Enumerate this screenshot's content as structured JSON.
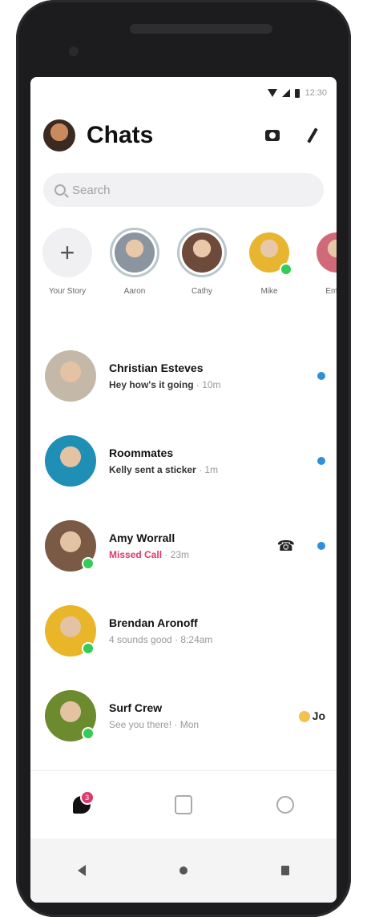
{
  "status_bar": {
    "time": "12:30"
  },
  "header": {
    "title": "Chats"
  },
  "search": {
    "placeholder": "Search"
  },
  "stories": [
    {
      "name": "Your Story",
      "type": "add"
    },
    {
      "name": "Aaron",
      "color": "#8b95a0"
    },
    {
      "name": "Cathy",
      "color": "#6e4a3a"
    },
    {
      "name": "Mike",
      "color": "#e8b531"
    },
    {
      "name": "Emilia",
      "color": "#d06a78"
    }
  ],
  "chats": [
    {
      "name": "Christian Esteves",
      "preview": "Hey how's it going",
      "time": "10m",
      "style": "unread",
      "avatar_color": "#c4b8a8",
      "unread": true,
      "call": false
    },
    {
      "name": "Roommates",
      "preview": "Kelly sent a sticker",
      "time": "1m",
      "style": "unread",
      "avatar_color": "#1f8fb5",
      "unread": true,
      "call": false
    },
    {
      "name": "Amy Worrall",
      "preview": "Missed Call",
      "time": "23m",
      "style": "pink",
      "avatar_color": "#7a5a45",
      "unread": true,
      "call": true
    },
    {
      "name": "Brendan Aronoff",
      "preview": "4 sounds good",
      "time": "8:24am",
      "style": "read",
      "avatar_color": "#e9b62a",
      "unread": false,
      "call": false
    },
    {
      "name": "Surf Crew",
      "preview": "See you there!",
      "time": "Mon",
      "style": "read",
      "avatar_color": "#6c8a2e",
      "unread": false,
      "call": false,
      "badge": "Jo"
    }
  ],
  "bottom_nav": {
    "badge": "3"
  }
}
